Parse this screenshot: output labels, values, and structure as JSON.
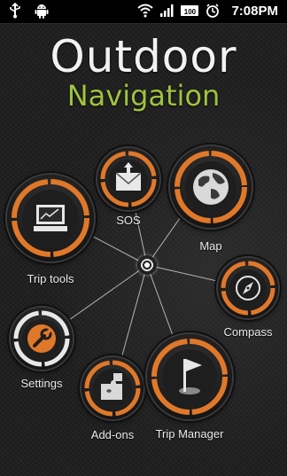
{
  "status_bar": {
    "time": "7:08PM",
    "battery_label": "100",
    "left_icons": [
      "usb-icon",
      "android-icon"
    ],
    "right_icons": [
      "wifi-icon",
      "signal-icon",
      "battery-icon",
      "alarm-icon"
    ]
  },
  "header": {
    "title": "Outdoor",
    "subtitle": "Navigation"
  },
  "menu": {
    "sos": "SOS",
    "map": "Map",
    "trip_tools": "Trip tools",
    "compass": "Compass",
    "settings": "Settings",
    "add_ons": "Add-ons",
    "trip_manager": "Trip Manager"
  },
  "colors": {
    "accent": "#e0782a",
    "subtitle": "#9fc33f",
    "ring": "#ffffff"
  }
}
